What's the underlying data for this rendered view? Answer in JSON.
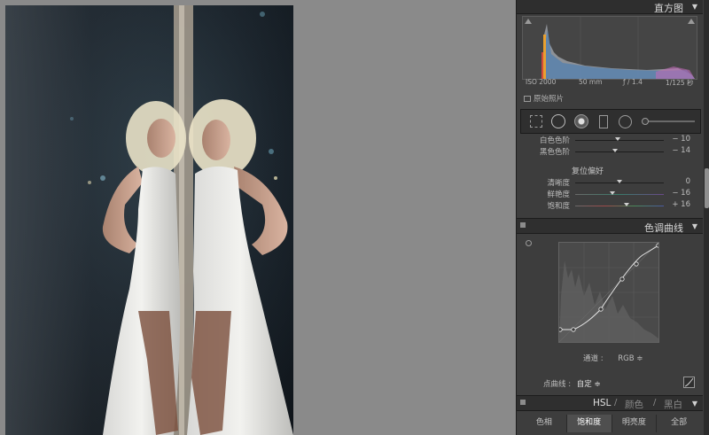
{
  "panel": {
    "histogram": {
      "title": "直方图",
      "iso": "ISO 2000",
      "focal": "50 mm",
      "aperture": "ƒ / 1.4",
      "shutter": "1/125 秒",
      "original_photo": "原始照片"
    },
    "tone": {
      "whites_label": "白色色阶",
      "whites_value": "− 10",
      "whites_level": 0.48,
      "blacks_label": "黑色色阶",
      "blacks_value": "− 14",
      "blacks_level": 0.45
    },
    "presence": {
      "title": "复位偏好",
      "clarity_label": "清晰度",
      "clarity_value": "0",
      "clarity_level": 0.5,
      "vibrance_label": "鲜艳度",
      "vibrance_value": "− 16",
      "vibrance_level": 0.42,
      "saturation_label": "饱和度",
      "saturation_value": "+ 16",
      "saturation_level": 0.58
    },
    "tone_curve": {
      "title": "色调曲线",
      "channel_label": "通道 :",
      "channel_value": "RGB ≑",
      "point_curve_label": "点曲线 :",
      "point_curve_value": "自定 ≑"
    },
    "hsl": {
      "title": "HSL",
      "sep1": "/",
      "color": "颜色",
      "sep2": "/",
      "bw": "黑白",
      "tabs": [
        "色相",
        "饱和度",
        "明亮度",
        "全部"
      ],
      "active_tab": 1
    }
  },
  "colors": {
    "panel_bg": "#3d3d3d",
    "header_bg": "#2e2e2e",
    "canvas_bg": "#8a8a8a"
  }
}
